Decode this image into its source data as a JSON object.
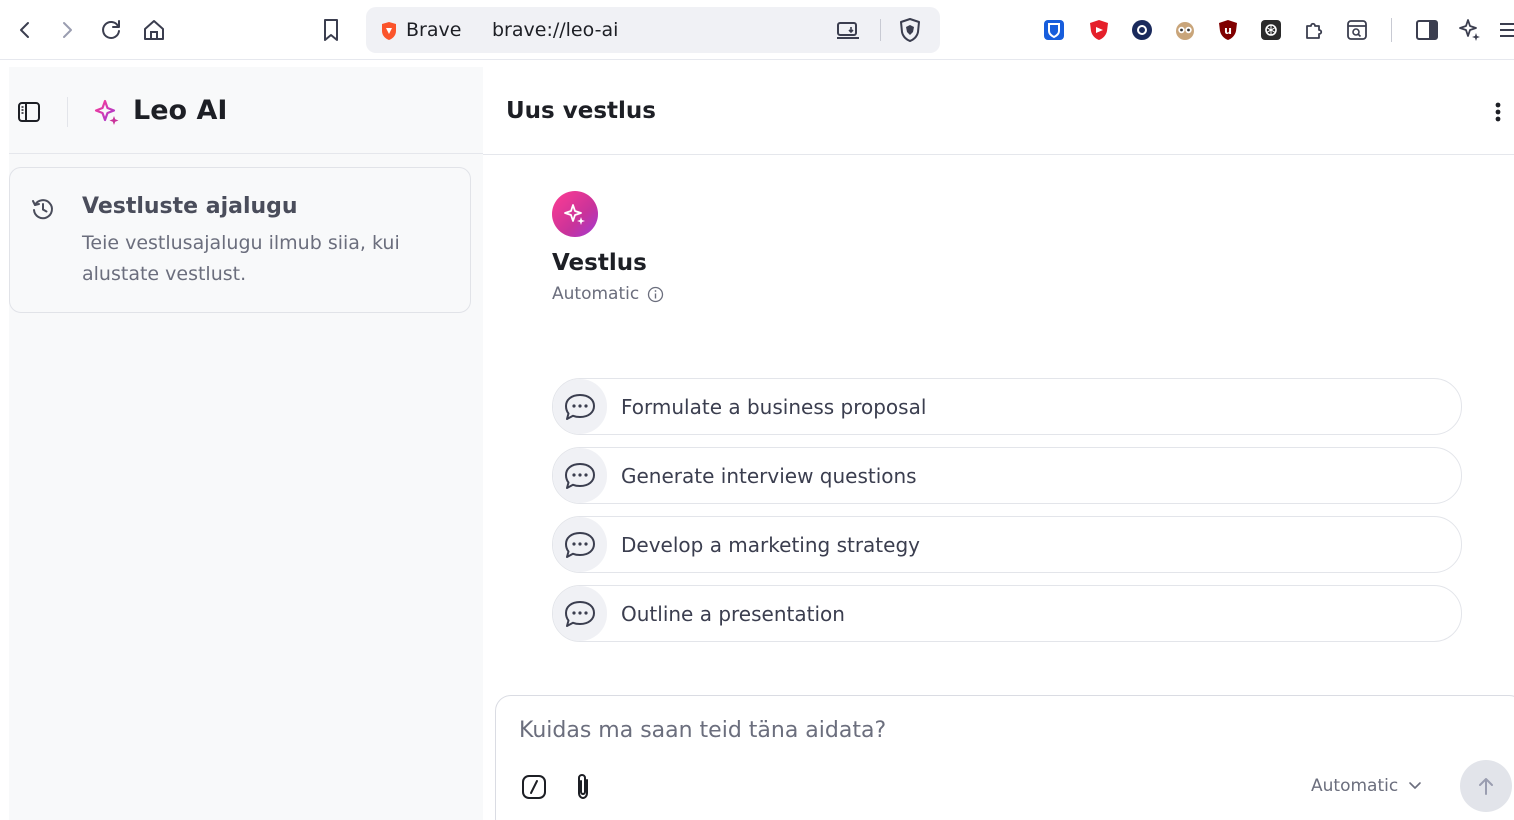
{
  "browser": {
    "brand_label": "Brave",
    "url": "brave://leo-ai",
    "extensions": [
      "bitwarden-icon",
      "ublock-like-shield-icon",
      "privacy-badger-icon",
      "owl-icon",
      "ublock-origin-icon",
      "chatgpt-icon",
      "extensions-puzzle-icon",
      "reader-mode-icon"
    ],
    "colors": {
      "brave_orange": "#fb542b",
      "bitwarden_blue": "#175ddc",
      "ublock_red": "#800000"
    }
  },
  "sidebar": {
    "title": "Leo AI",
    "history": {
      "title": "Vestluste ajalugu",
      "text": "Teie vestlusajalugu ilmub siia, kui alustate vestlust."
    }
  },
  "main": {
    "title": "Uus vestlus",
    "model": {
      "name": "Vestlus",
      "mode": "Automatic"
    },
    "suggestions": [
      {
        "label": "Formulate a business proposal"
      },
      {
        "label": "Generate interview questions"
      },
      {
        "label": "Develop a marketing strategy"
      },
      {
        "label": "Outline a presentation"
      }
    ],
    "composer": {
      "placeholder": "Kuidas ma saan teid täna aidata?",
      "model_select": "Automatic"
    },
    "colors": {
      "leo_pink": "#ff3c92",
      "leo_purple": "#a23ad4"
    }
  }
}
